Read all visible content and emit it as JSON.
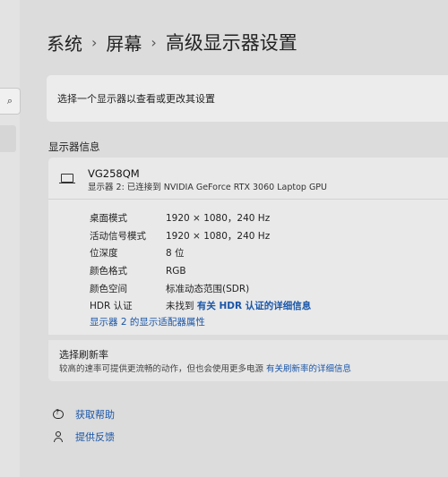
{
  "breadcrumb": {
    "items": [
      "系统",
      "屏幕",
      "高级显示器设置"
    ],
    "separator": "›"
  },
  "select_display": {
    "label": "选择一个显示器以查看或更改其设置"
  },
  "section_title": "显示器信息",
  "monitor": {
    "name": "VG258QM",
    "subtitle": "显示器 2: 已连接到 NVIDIA GeForce RTX 3060 Laptop GPU",
    "properties": [
      {
        "label": "桌面模式",
        "value": "1920 × 1080，240 Hz"
      },
      {
        "label": "活动信号模式",
        "value": "1920 × 1080，240 Hz"
      },
      {
        "label": "位深度",
        "value": "8 位"
      },
      {
        "label": "颜色格式",
        "value": "RGB"
      },
      {
        "label": "颜色空间",
        "value": "标准动态范围(SDR)"
      }
    ],
    "hdr": {
      "label": "HDR 认证",
      "value": "未找到",
      "link": "有关 HDR 认证的详细信息"
    },
    "adapter_link": "显示器 2 的显示适配器属性"
  },
  "refresh": {
    "title": "选择刷新率",
    "description": "较高的速率可提供更流畅的动作，但也会使用更多电源",
    "link": "有关刷新率的详细信息"
  },
  "help": {
    "get_help": "获取帮助",
    "feedback": "提供反馈"
  },
  "icons": {
    "search": "search-icon",
    "monitor": "monitor-icon",
    "help": "help-icon",
    "feedback": "feedback-icon"
  },
  "colors": {
    "link": "#1a56a8",
    "background": "#dcdcdc",
    "card": "#e9e9e9"
  }
}
